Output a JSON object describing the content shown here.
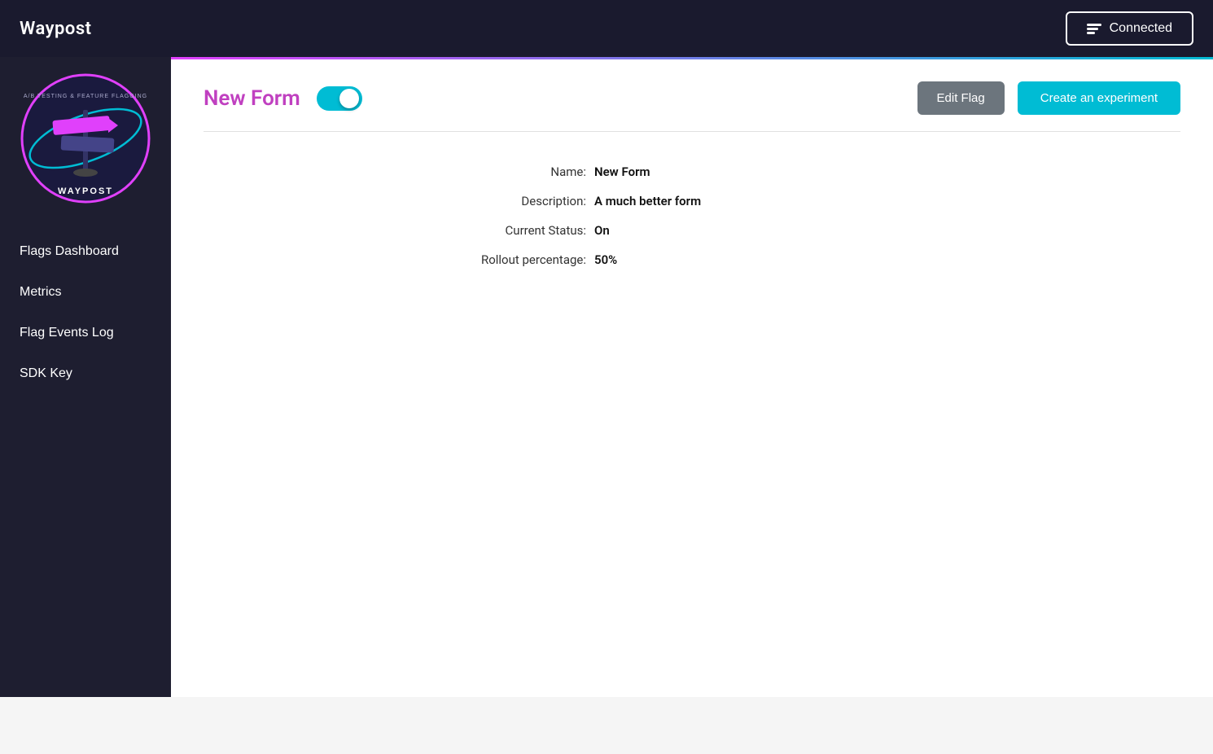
{
  "navbar": {
    "brand": "Waypost",
    "connected_label": "Connected"
  },
  "sidebar": {
    "items": [
      {
        "label": "Flags Dashboard",
        "id": "flags-dashboard"
      },
      {
        "label": "Metrics",
        "id": "metrics"
      },
      {
        "label": "Flag Events Log",
        "id": "flag-events-log"
      },
      {
        "label": "SDK Key",
        "id": "sdk-key"
      }
    ]
  },
  "main": {
    "flag_title": "New Form",
    "toggle_on": true,
    "edit_flag_label": "Edit Flag",
    "create_experiment_label": "Create an experiment",
    "details": {
      "name_label": "Name:",
      "name_value": "New Form",
      "description_label": "Description:",
      "description_value": "A much better form",
      "status_label": "Current Status:",
      "status_value": "On",
      "rollout_label": "Rollout percentage:",
      "rollout_value": "50%"
    }
  }
}
